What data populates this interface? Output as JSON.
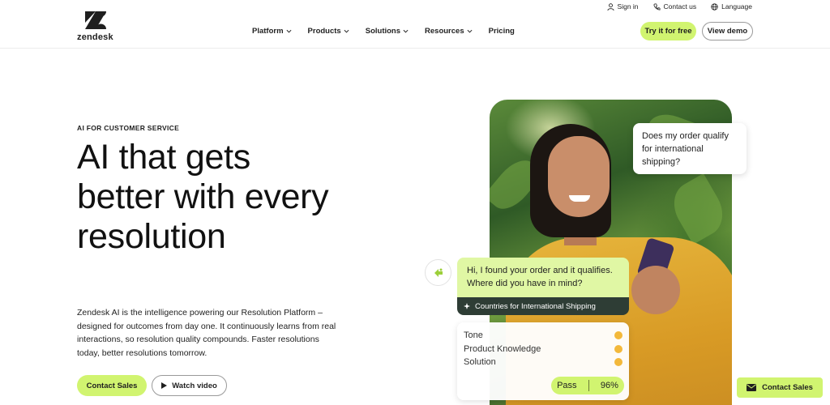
{
  "brand": {
    "name": "zendesk"
  },
  "utility_links": [
    {
      "label": "Sign in",
      "icon": "user-icon"
    },
    {
      "label": "Contact us",
      "icon": "phone-icon"
    },
    {
      "label": "Language",
      "icon": "globe-icon"
    }
  ],
  "nav": {
    "items": [
      {
        "label": "Platform",
        "has_dropdown": true
      },
      {
        "label": "Products",
        "has_dropdown": true
      },
      {
        "label": "Solutions",
        "has_dropdown": true
      },
      {
        "label": "Resources",
        "has_dropdown": true
      },
      {
        "label": "Pricing",
        "has_dropdown": false
      }
    ],
    "try_label": "Try it for free",
    "demo_label": "View demo"
  },
  "hero": {
    "eyebrow": "AI FOR CUSTOMER SERVICE",
    "headline": "AI that gets better with every resolution",
    "description": "Zendesk AI is the intelligence powering our Resolution Platform – designed for outcomes from day one. It continuously learns from real interactions, so resolution quality compounds. Faster resolutions today, better resolutions tomorrow.",
    "primary_cta": "Contact Sales",
    "secondary_cta": "Watch video"
  },
  "chat": {
    "customer_question": "Does my order qualify for international shipping?",
    "bot_reply": "Hi, I found your order and it qualifies. Where did you have in mind?",
    "source_tag": "Countries for International Shipping",
    "scores": [
      {
        "label": "Tone"
      },
      {
        "label": "Product Knowledge"
      },
      {
        "label": "Solution"
      }
    ],
    "result_label": "Pass",
    "result_score": "96%"
  },
  "floating_contact": {
    "label": "Contact Sales"
  },
  "colors": {
    "accent": "#d1f470",
    "tag_bg": "#2e3d35",
    "bubble_green": "#e0f7a4"
  }
}
